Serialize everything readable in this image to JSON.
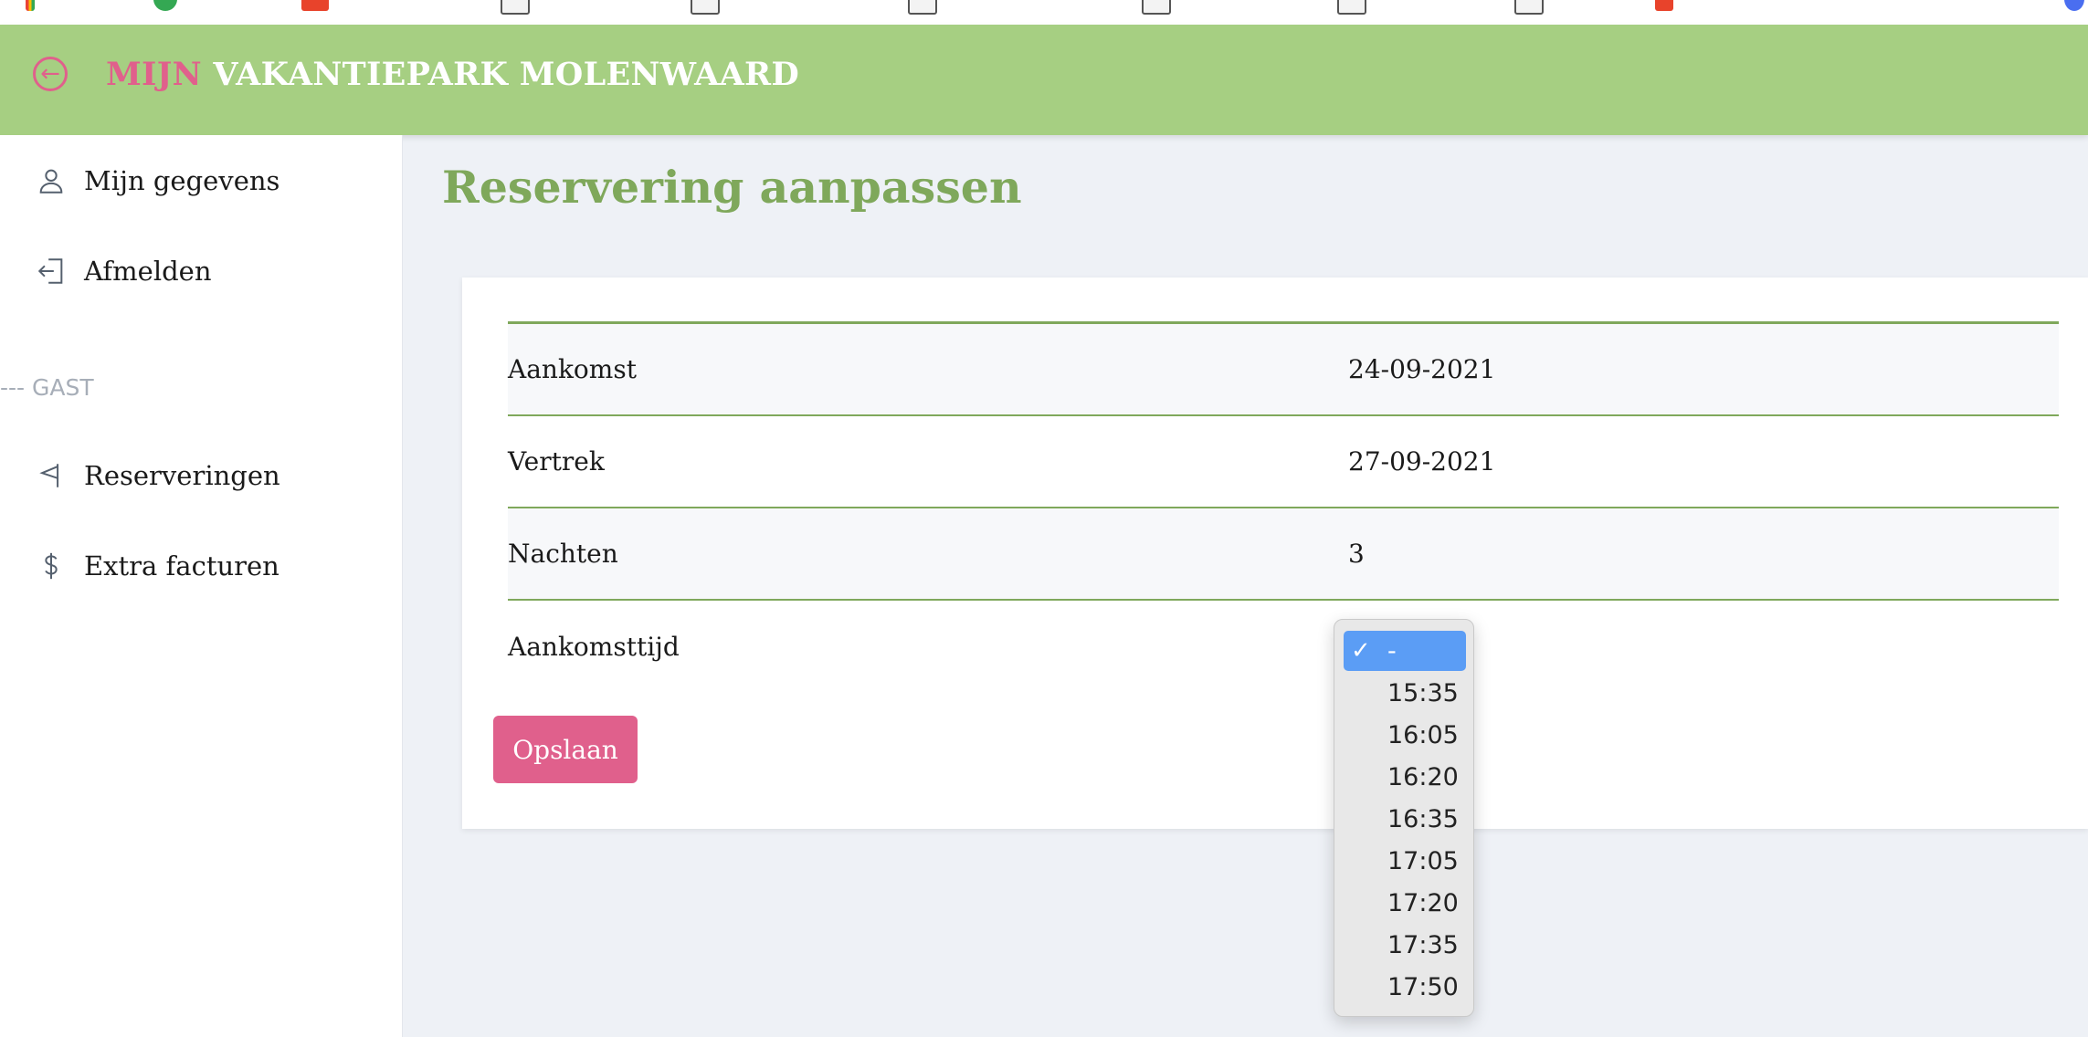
{
  "header": {
    "brand_highlight": "MIJN",
    "brand_rest": "VAKANTIEPARK MOLENWAARD"
  },
  "sidebar": {
    "items": [
      {
        "label": "Mijn gegevens",
        "icon": "user-icon"
      },
      {
        "label": "Afmelden",
        "icon": "logout-icon"
      }
    ],
    "section_label": "--- GAST",
    "guest_items": [
      {
        "label": "Reserveringen",
        "icon": "flag-icon"
      },
      {
        "label": "Extra facturen",
        "icon": "dollar-icon"
      }
    ]
  },
  "main": {
    "title": "Reservering aanpassen",
    "rows": [
      {
        "label": "Aankomst",
        "value": "24-09-2021"
      },
      {
        "label": "Vertrek",
        "value": "27-09-2021"
      },
      {
        "label": "Nachten",
        "value": "3"
      },
      {
        "label": "Aankomsttijd",
        "value": "-"
      }
    ],
    "save_label": "Opslaan"
  },
  "arrival_time_dropdown": {
    "check_mark": "✓",
    "selected": "-",
    "options": [
      "-",
      "15:35",
      "16:05",
      "16:20",
      "16:35",
      "17:05",
      "17:20",
      "17:35",
      "17:50"
    ]
  },
  "colors": {
    "header_green": "#a6cf82",
    "title_green": "#7fa85b",
    "accent_pink": "#e0608c",
    "select_blue": "#5b9df5"
  }
}
